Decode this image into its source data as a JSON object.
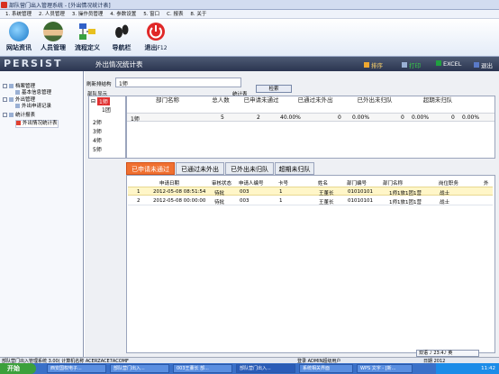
{
  "window": {
    "title": "部队营门出入管理系统 - [外出情况统计表]"
  },
  "menu": [
    "1. 系统管理",
    "2. 人员管理",
    "3. 操作员管理",
    "4. 参数设置",
    "5. 窗口",
    "C. 报表",
    "8. 关于"
  ],
  "toolbar": [
    {
      "label": "网站资讯",
      "icon": "globe-icon"
    },
    {
      "label": "人员管理",
      "icon": "soldier-icon"
    },
    {
      "label": "流程定义",
      "icon": "flowchart-icon"
    },
    {
      "label": "导航栏",
      "icon": "footprint-icon"
    },
    {
      "label": "退出",
      "hotkey": "F12",
      "icon": "power-icon"
    }
  ],
  "header": {
    "logo": "PERSIST",
    "page_title": "外出情况统计表",
    "buttons": [
      {
        "label": "排序",
        "icon": "sort-icon"
      },
      {
        "label": "打印",
        "icon": "print-icon"
      },
      {
        "label": "EXCEL",
        "icon": "excel-icon"
      },
      {
        "label": "退出",
        "icon": "exit-icon"
      }
    ]
  },
  "nav": {
    "groups": [
      {
        "label": "档案管理",
        "children": [
          "基本信息管理"
        ]
      },
      {
        "label": "外出管理",
        "children": [
          "外出申请记录"
        ]
      },
      {
        "label": "统计报表",
        "children": [
          "外出情况统计表"
        ]
      }
    ]
  },
  "filter": {
    "dept_label": "刷新排结构",
    "dept_value": "1师",
    "query_label": "检索",
    "tree_label": "部队显示",
    "stat_label": "统计表"
  },
  "tree": {
    "nodes": [
      "1师",
      "1团",
      "2师",
      "3师",
      "4师",
      "5师"
    ]
  },
  "stat": {
    "headers": [
      "部门名称",
      "总人数",
      "已申请未通过",
      "已通过未外出",
      "已外出未归队",
      "超期未归队"
    ],
    "row": [
      "1师",
      "5",
      "2",
      "40.00%",
      "0",
      "0.00%",
      "0",
      "0.00%",
      "0",
      "0.00%"
    ]
  },
  "tabs": [
    "已申请未通过",
    "已通过未外出",
    "已外出未归队",
    "超期未归队"
  ],
  "detail": {
    "headers": [
      "申请日期",
      "审核状态",
      "申请人编号",
      "卡号",
      "姓名",
      "部门编号",
      "部门名称",
      "岗位职务",
      "外"
    ],
    "rows": [
      [
        "1",
        "2012-05-08 08:51:54",
        "待批",
        "003",
        "1",
        "王董长",
        "01010101",
        "1师1旅1团1营",
        "战士"
      ],
      [
        "2",
        "2012-05-08 00:00:00",
        "待批",
        "003",
        "1",
        "王董长",
        "01010101",
        "1师1旅1团1营",
        "战士"
      ]
    ]
  },
  "statusbar": {
    "left": "部队营门出入管理系统 3.00( 计算机名称 ACERZACE7ACOMF",
    "mid": "登录 ADMIN超级用户",
    "right": "日期 2012"
  },
  "ime": "双语 ♪ 23:4♪ 英",
  "taskbar": {
    "start": "开始",
    "tasks": [
      "西安国权电子...",
      "部队营门出入...",
      "003王董长 部...",
      "部队营门出入...",
      "系统相关界面",
      "WPS 文字 - [新..."
    ],
    "clock": "11:42"
  }
}
